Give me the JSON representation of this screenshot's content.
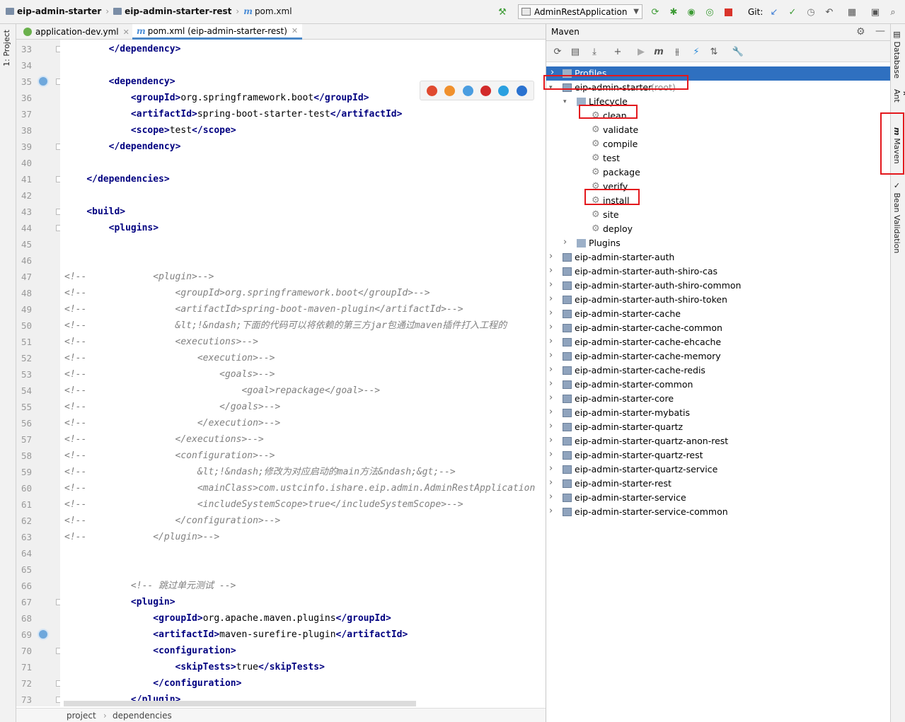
{
  "breadcrumbs": [
    "eip-admin-starter",
    "eip-admin-starter-rest",
    "pom.xml"
  ],
  "run_config": "AdminRestApplication",
  "git_label": "Git:",
  "left_tool_tab": "1: Project",
  "editor_tabs": [
    {
      "label": "application-dev.yml",
      "active": false
    },
    {
      "label": "pom.xml (eip-admin-starter-rest)",
      "active": true
    }
  ],
  "code_lines": [
    {
      "n": "33",
      "t": "        </dependency>"
    },
    {
      "n": "34",
      "t": ""
    },
    {
      "n": "35",
      "t": "        <dependency>"
    },
    {
      "n": "36",
      "t": "            <groupId>org.springframework.boot</groupId>"
    },
    {
      "n": "37",
      "t": "            <artifactId>spring-boot-starter-test</artifactId>"
    },
    {
      "n": "38",
      "t": "            <scope>test</scope>"
    },
    {
      "n": "39",
      "t": "        </dependency>"
    },
    {
      "n": "40",
      "t": ""
    },
    {
      "n": "41",
      "t": "    </dependencies>"
    },
    {
      "n": "42",
      "t": ""
    },
    {
      "n": "43",
      "t": "    <build>"
    },
    {
      "n": "44",
      "t": "        <plugins>"
    },
    {
      "n": "45",
      "t": ""
    },
    {
      "n": "46",
      "t": ""
    },
    {
      "n": "47",
      "t": "<!--            <plugin>-->"
    },
    {
      "n": "48",
      "t": "<!--                <groupId>org.springframework.boot</groupId>-->"
    },
    {
      "n": "49",
      "t": "<!--                <artifactId>spring-boot-maven-plugin</artifactId>-->"
    },
    {
      "n": "50",
      "t": "<!--                &lt;!&ndash;下面的代码可以将依赖的第三方jar包通过maven插件打入工程的"
    },
    {
      "n": "51",
      "t": "<!--                <executions>-->"
    },
    {
      "n": "52",
      "t": "<!--                    <execution>-->"
    },
    {
      "n": "53",
      "t": "<!--                        <goals>-->"
    },
    {
      "n": "54",
      "t": "<!--                            <goal>repackage</goal>-->"
    },
    {
      "n": "55",
      "t": "<!--                        </goals>-->"
    },
    {
      "n": "56",
      "t": "<!--                    </execution>-->"
    },
    {
      "n": "57",
      "t": "<!--                </executions>-->"
    },
    {
      "n": "58",
      "t": "<!--                <configuration>-->"
    },
    {
      "n": "59",
      "t": "<!--                    &lt;!&ndash;修改为对应启动的main方法&ndash;&gt;-->"
    },
    {
      "n": "60",
      "t": "<!--                    <mainClass>com.ustcinfo.ishare.eip.admin.AdminRestApplication"
    },
    {
      "n": "61",
      "t": "<!--                    <includeSystemScope>true</includeSystemScope>-->"
    },
    {
      "n": "62",
      "t": "<!--                </configuration>-->"
    },
    {
      "n": "63",
      "t": "<!--            </plugin>-->"
    },
    {
      "n": "64",
      "t": ""
    },
    {
      "n": "65",
      "t": ""
    },
    {
      "n": "66",
      "t": "            <!-- 跳过单元测试 -->"
    },
    {
      "n": "67",
      "t": "            <plugin>"
    },
    {
      "n": "68",
      "t": "                <groupId>org.apache.maven.plugins</groupId>"
    },
    {
      "n": "69",
      "t": "                <artifactId>maven-surefire-plugin</artifactId>"
    },
    {
      "n": "70",
      "t": "                <configuration>"
    },
    {
      "n": "71",
      "t": "                    <skipTests>true</skipTests>"
    },
    {
      "n": "72",
      "t": "                </configuration>"
    },
    {
      "n": "73",
      "t": "            </plugin>"
    }
  ],
  "status_breadcrumb": [
    "project",
    "dependencies"
  ],
  "maven_panel": {
    "title": "Maven",
    "profiles": "Profiles",
    "root": {
      "name": "eip-admin-starter",
      "suffix": "(root)"
    },
    "lifecycle_label": "Lifecycle",
    "lifecycle": [
      "clean",
      "validate",
      "compile",
      "test",
      "package",
      "verify",
      "install",
      "site",
      "deploy"
    ],
    "plugins_label": "Plugins",
    "modules": [
      "eip-admin-starter-auth",
      "eip-admin-starter-auth-shiro-cas",
      "eip-admin-starter-auth-shiro-common",
      "eip-admin-starter-auth-shiro-token",
      "eip-admin-starter-cache",
      "eip-admin-starter-cache-common",
      "eip-admin-starter-cache-ehcache",
      "eip-admin-starter-cache-memory",
      "eip-admin-starter-cache-redis",
      "eip-admin-starter-common",
      "eip-admin-starter-core",
      "eip-admin-starter-mybatis",
      "eip-admin-starter-quartz",
      "eip-admin-starter-quartz-anon-rest",
      "eip-admin-starter-quartz-rest",
      "eip-admin-starter-quartz-service",
      "eip-admin-starter-rest",
      "eip-admin-starter-service",
      "eip-admin-starter-service-common"
    ]
  },
  "right_tool_tabs": [
    "Database",
    "Ant",
    "Maven",
    "Bean Validation"
  ]
}
